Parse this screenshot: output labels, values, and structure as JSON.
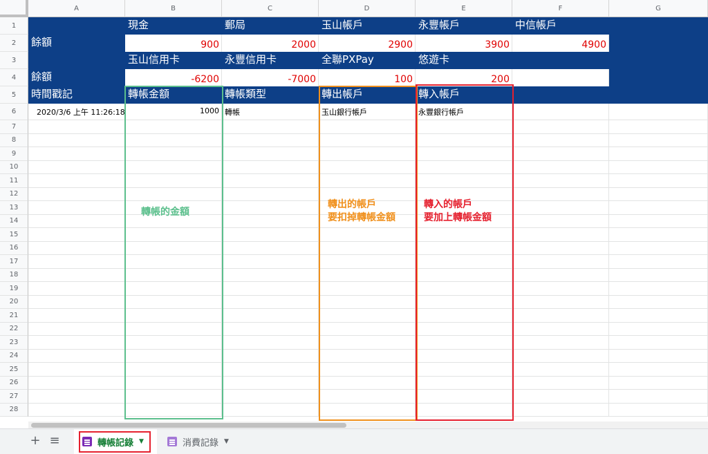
{
  "columns": [
    "A",
    "B",
    "C",
    "D",
    "E",
    "F",
    "G"
  ],
  "row_numbers": [
    "1",
    "2",
    "3",
    "4",
    "5",
    "6",
    "7",
    "8",
    "9",
    "10",
    "11",
    "12",
    "13",
    "14",
    "15",
    "16",
    "17",
    "18",
    "19",
    "20",
    "21",
    "22",
    "23",
    "24",
    "25",
    "26",
    "27",
    "28"
  ],
  "header": {
    "row1": [
      "",
      "現金",
      "郵局",
      "玉山帳戶",
      "永豐帳戶",
      "中信帳戶"
    ],
    "row2_label": "餘額",
    "row2_values": [
      "900",
      "2000",
      "2900",
      "3900",
      "4900"
    ],
    "row3": [
      "",
      "玉山信用卡",
      "永豐信用卡",
      "全聯PXPay",
      "悠遊卡",
      ""
    ],
    "row4_label": "餘額",
    "row4_values": [
      "-6200",
      "-7000",
      "100",
      "200",
      ""
    ],
    "row5": [
      "時間戳記",
      "轉帳金額",
      "轉帳類型",
      "轉出帳戶",
      "轉入帳戶",
      ""
    ]
  },
  "data_rows": [
    [
      "2020/3/6 上午 11:26:18",
      "1000",
      "轉帳",
      "玉山銀行帳戶",
      "永豐銀行帳戶",
      "",
      ""
    ]
  ],
  "annotations": {
    "amount_note": "轉帳的金額",
    "out_note_line1": "轉出的帳戶",
    "out_note_line2": "要扣掉轉帳金額",
    "in_note_line1": "轉入的帳戶",
    "in_note_line2": "要加上轉帳金額"
  },
  "colors": {
    "header_blue": "#0d3f87",
    "value_red": "#e00000",
    "frame_green": "#5bbf8c",
    "frame_orange": "#f0901c",
    "frame_red": "#e5202e"
  },
  "tabs": [
    {
      "label": "轉帳記錄",
      "active": true,
      "icon": "sheet-list-icon"
    },
    {
      "label": "消費記錄",
      "active": false,
      "icon": "sheet-list-icon"
    }
  ],
  "toolbar_icons": {
    "add": "plus-icon",
    "all_sheets": "menu-lines-icon"
  }
}
